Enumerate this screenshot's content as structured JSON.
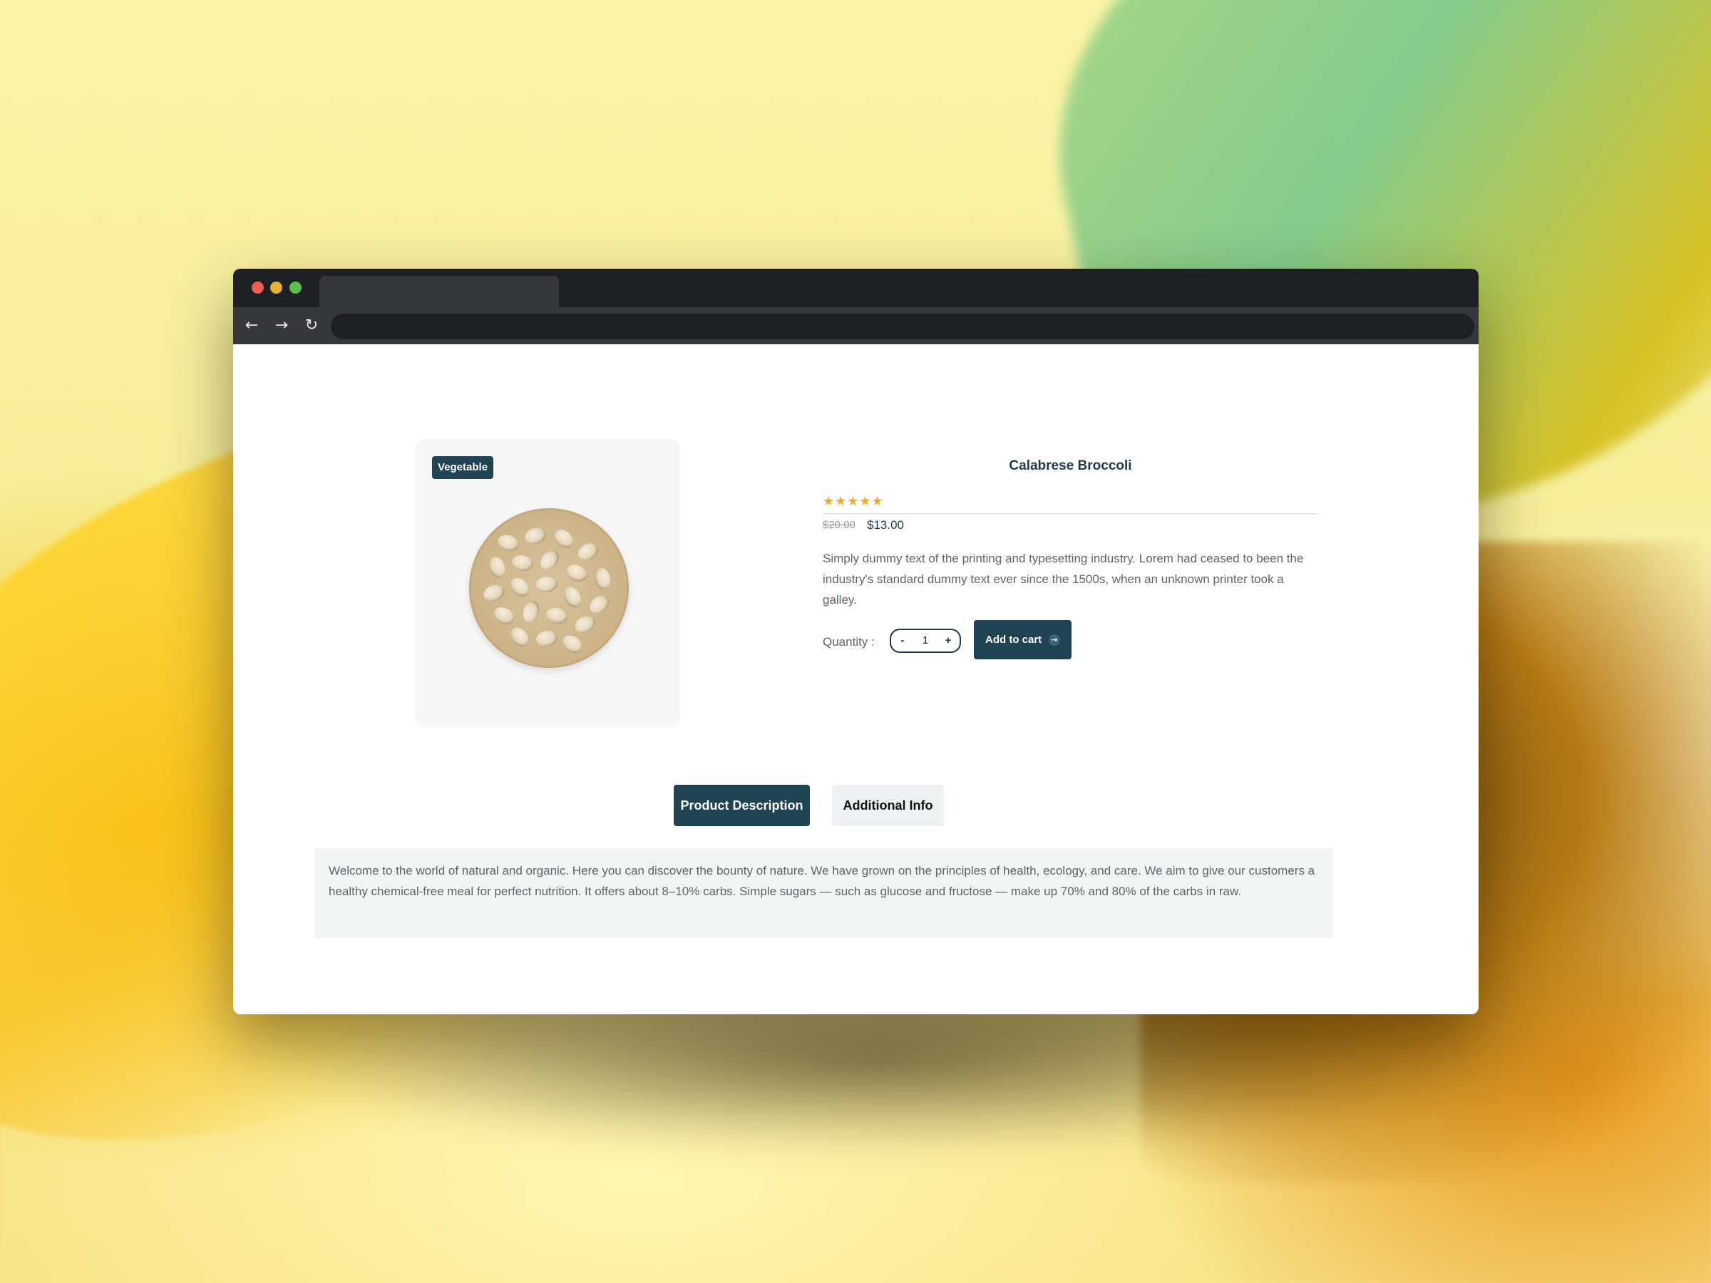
{
  "product": {
    "badge": "Vegetable",
    "title": "Calabrese Broccoli",
    "rating": 5,
    "rating_max": 5,
    "stars": "★★★★★",
    "price_old": "$20.00",
    "price_new": "$13.00",
    "description": "Simply dummy text of the printing and typesetting industry. Lorem had ceased to been the industry's standard dummy text ever since the 1500s, when an unknown printer took a galley.",
    "quantity_label": "Quantity :",
    "quantity_value": "1",
    "minus_label": "-",
    "plus_label": "+",
    "add_to_cart_label": "Add to cart",
    "image_icon": "bowl-of-pistachios"
  },
  "tabs": {
    "product_description": "Product Description",
    "additional_info": "Additional Info",
    "active": "product_description"
  },
  "panel": {
    "text": "Welcome to the world of natural and organic. Here you can discover the bounty of nature. We have grown on the principles of health, ecology, and care. We aim to give our customers a healthy chemical-free meal for perfect nutrition. It offers about 8–10% carbs. Simple sugars — such as glucose and fructose — make up 70% and 80% of the carbs in raw."
  },
  "browser": {
    "nav_back_icon": "←",
    "nav_forward_icon": "→",
    "nav_reload_icon": "↻",
    "cart_arrow_icon": "→"
  },
  "colors": {
    "accent": "#1f4352",
    "star": "#f5a623",
    "panel_bg": "#f3f4f4"
  }
}
